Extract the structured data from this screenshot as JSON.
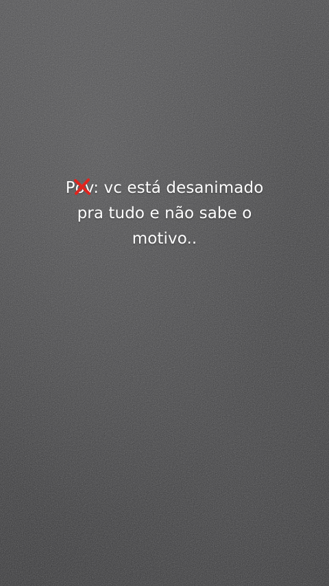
{
  "caption": {
    "prefix_start": "P",
    "prefix_crossed": "o",
    "line1_rest": "v: vc está desanimado",
    "line2": "pra tudo e não sabe o",
    "line3": "motivo.."
  },
  "colors": {
    "background": "#3a3a3c",
    "text": "#ffffff",
    "cross_mark": "#e0241e"
  },
  "icons": {
    "cross_mark": "x-mark-icon"
  }
}
